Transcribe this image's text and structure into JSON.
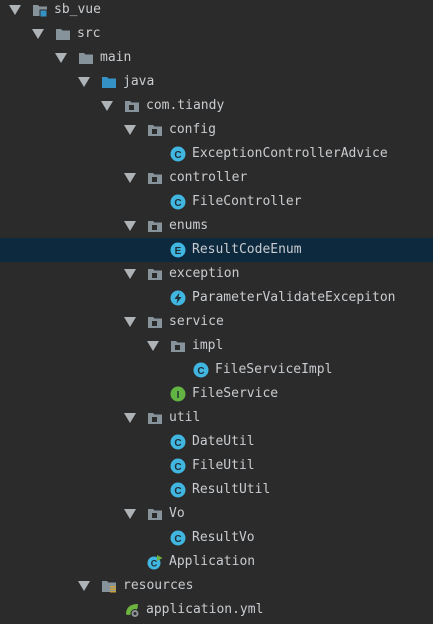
{
  "tree": [
    {
      "label": "sb_vue",
      "depth": 0,
      "expanded": true,
      "icon": "module-folder-icon"
    },
    {
      "label": "src",
      "depth": 1,
      "expanded": true,
      "icon": "folder-icon"
    },
    {
      "label": "main",
      "depth": 2,
      "expanded": true,
      "icon": "folder-icon"
    },
    {
      "label": "java",
      "depth": 3,
      "expanded": true,
      "icon": "source-root-folder-icon"
    },
    {
      "label": "com.tiandy",
      "depth": 4,
      "expanded": true,
      "icon": "package-icon"
    },
    {
      "label": "config",
      "depth": 5,
      "expanded": true,
      "icon": "package-icon"
    },
    {
      "label": "ExceptionControllerAdvice",
      "depth": 6,
      "expanded": null,
      "icon": "class-icon"
    },
    {
      "label": "controller",
      "depth": 5,
      "expanded": true,
      "icon": "package-icon"
    },
    {
      "label": "FileController",
      "depth": 6,
      "expanded": null,
      "icon": "class-icon"
    },
    {
      "label": "enums",
      "depth": 5,
      "expanded": true,
      "icon": "package-icon"
    },
    {
      "label": "ResultCodeEnum",
      "depth": 6,
      "expanded": null,
      "icon": "enum-icon",
      "selected": true
    },
    {
      "label": "exception",
      "depth": 5,
      "expanded": true,
      "icon": "package-icon"
    },
    {
      "label": "ParameterValidateExcepiton",
      "depth": 6,
      "expanded": null,
      "icon": "exception-class-icon"
    },
    {
      "label": "service",
      "depth": 5,
      "expanded": true,
      "icon": "package-icon"
    },
    {
      "label": "impl",
      "depth": 6,
      "expanded": true,
      "icon": "package-icon"
    },
    {
      "label": "FileServiceImpl",
      "depth": 7,
      "expanded": null,
      "icon": "class-icon"
    },
    {
      "label": "FileService",
      "depth": 6,
      "expanded": null,
      "icon": "interface-icon"
    },
    {
      "label": "util",
      "depth": 5,
      "expanded": true,
      "icon": "package-icon"
    },
    {
      "label": "DateUtil",
      "depth": 6,
      "expanded": null,
      "icon": "class-icon"
    },
    {
      "label": "FileUtil",
      "depth": 6,
      "expanded": null,
      "icon": "class-icon"
    },
    {
      "label": "ResultUtil",
      "depth": 6,
      "expanded": null,
      "icon": "class-icon"
    },
    {
      "label": "Vo",
      "depth": 5,
      "expanded": true,
      "icon": "package-icon"
    },
    {
      "label": "ResultVo",
      "depth": 6,
      "expanded": null,
      "icon": "class-icon"
    },
    {
      "label": "Application",
      "depth": 5,
      "expanded": null,
      "icon": "spring-boot-app-icon"
    },
    {
      "label": "resources",
      "depth": 3,
      "expanded": true,
      "icon": "resources-folder-icon"
    },
    {
      "label": "application.yml",
      "depth": 4,
      "expanded": null,
      "icon": "spring-config-file-icon"
    }
  ],
  "colors": {
    "background": "#2b2b2b",
    "selected_row": "#0d293e",
    "text": "#c8ccd0",
    "folder": "#87939a",
    "source_root": "#3592c4",
    "class_icon": "#40b6e0",
    "interface_icon": "#62b543",
    "spring_green": "#6db33f"
  }
}
